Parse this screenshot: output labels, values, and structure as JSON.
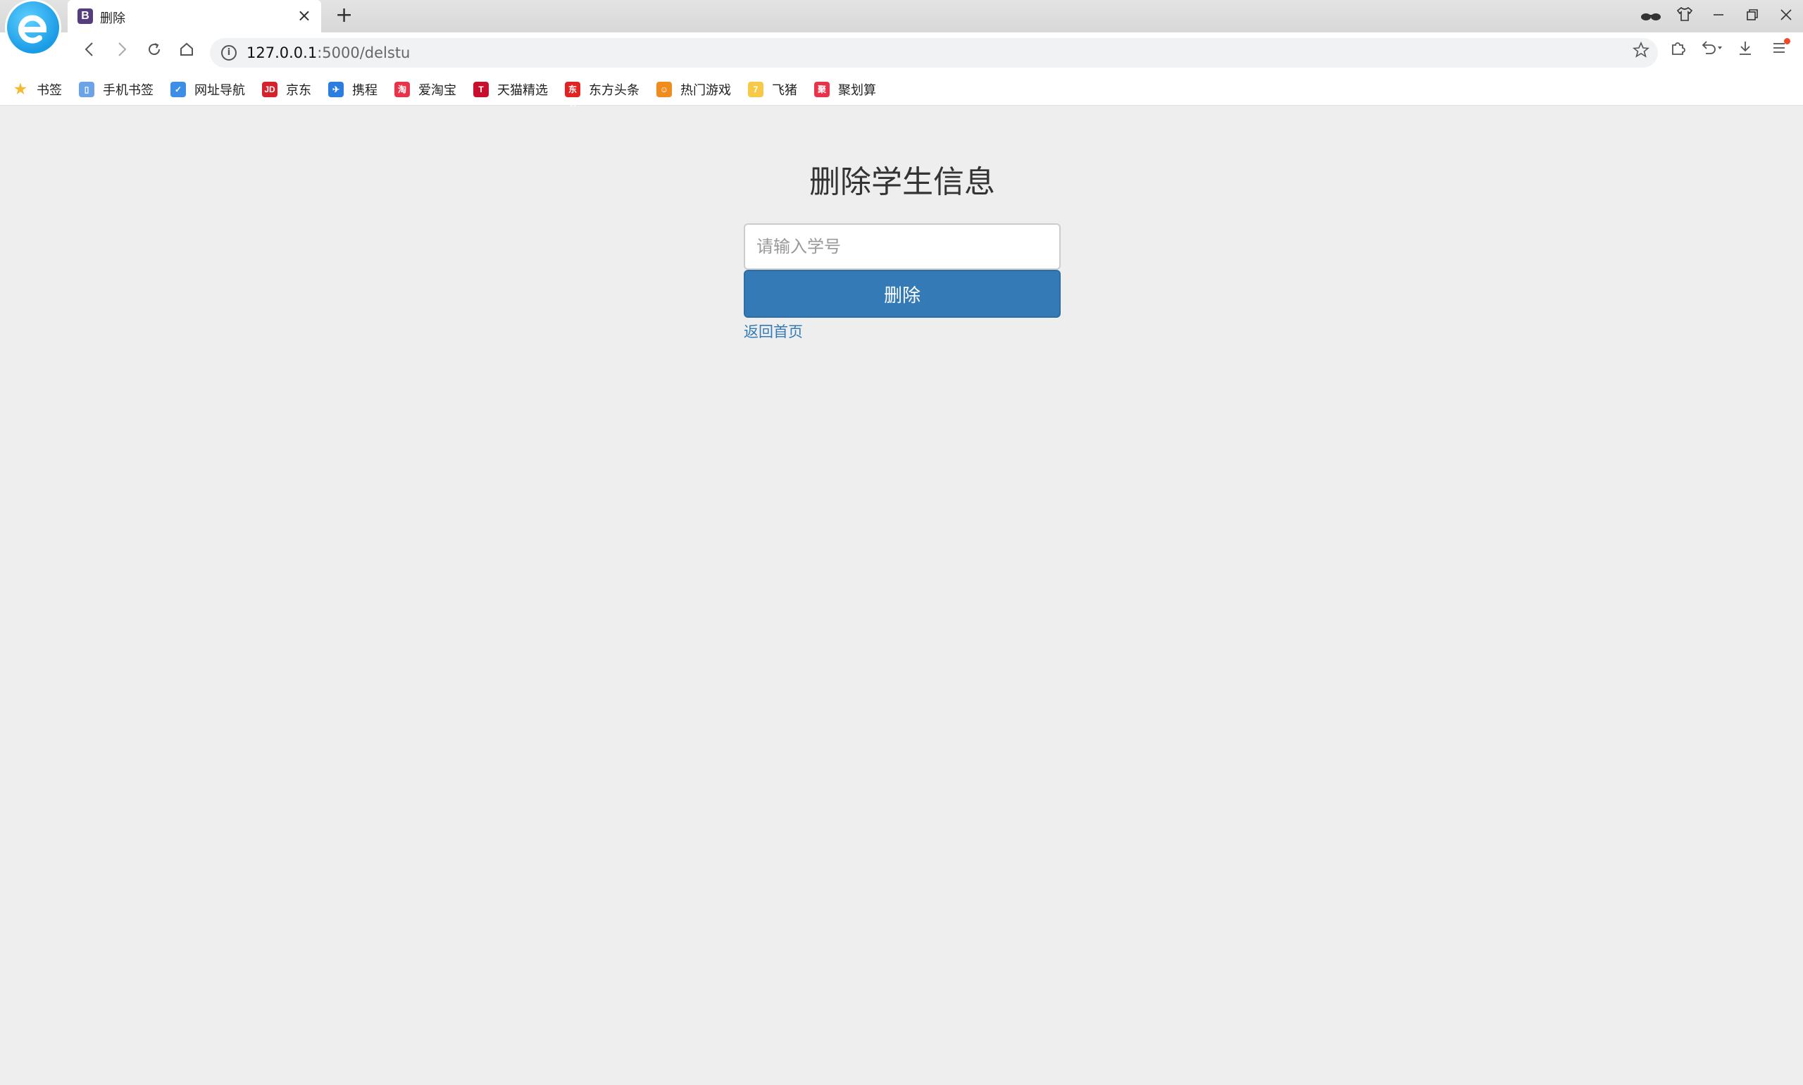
{
  "browser": {
    "tab_title": "删除",
    "tab_favicon": "B",
    "tab_close": "×",
    "new_tab": "+",
    "url_host": "127.0.0.1",
    "url_rest": ":5000/delstu",
    "info_glyph": "i"
  },
  "bookmarks": [
    {
      "label": "书签",
      "icon": "star-icon",
      "color": "#f5b82e",
      "glyph": "★"
    },
    {
      "label": "手机书签",
      "icon": "phone-bookmark-icon",
      "color": "#6aa3e8",
      "glyph": "▯"
    },
    {
      "label": "网址导航",
      "icon": "navigation-icon",
      "color": "#3d8ee6",
      "glyph": "✓"
    },
    {
      "label": "京东",
      "icon": "jd-icon",
      "color": "#d4232b",
      "glyph": "JD"
    },
    {
      "label": "携程",
      "icon": "ctrip-icon",
      "color": "#2b7de0",
      "glyph": "✈"
    },
    {
      "label": "爱淘宝",
      "icon": "taobao-icon",
      "color": "#e8334a",
      "glyph": "淘"
    },
    {
      "label": "天猫精选",
      "icon": "tmall-icon",
      "color": "#c8102e",
      "glyph": "T"
    },
    {
      "label": "东方头条",
      "icon": "dftt-icon",
      "color": "#e02424",
      "glyph": "东方"
    },
    {
      "label": "热门游戏",
      "icon": "games-icon",
      "color": "#f08c1e",
      "glyph": "☺"
    },
    {
      "label": "飞猪",
      "icon": "fliggy-icon",
      "color": "#f7c948",
      "glyph": "7"
    },
    {
      "label": "聚划算",
      "icon": "juhuasuan-icon",
      "color": "#e8334a",
      "glyph": "聚"
    }
  ],
  "page": {
    "title": "删除学生信息",
    "input_placeholder": "请输入学号",
    "delete_label": "删除",
    "back_link": "返回首页"
  },
  "colors": {
    "primary": "#337ab7",
    "page_bg": "#eeeeee"
  }
}
